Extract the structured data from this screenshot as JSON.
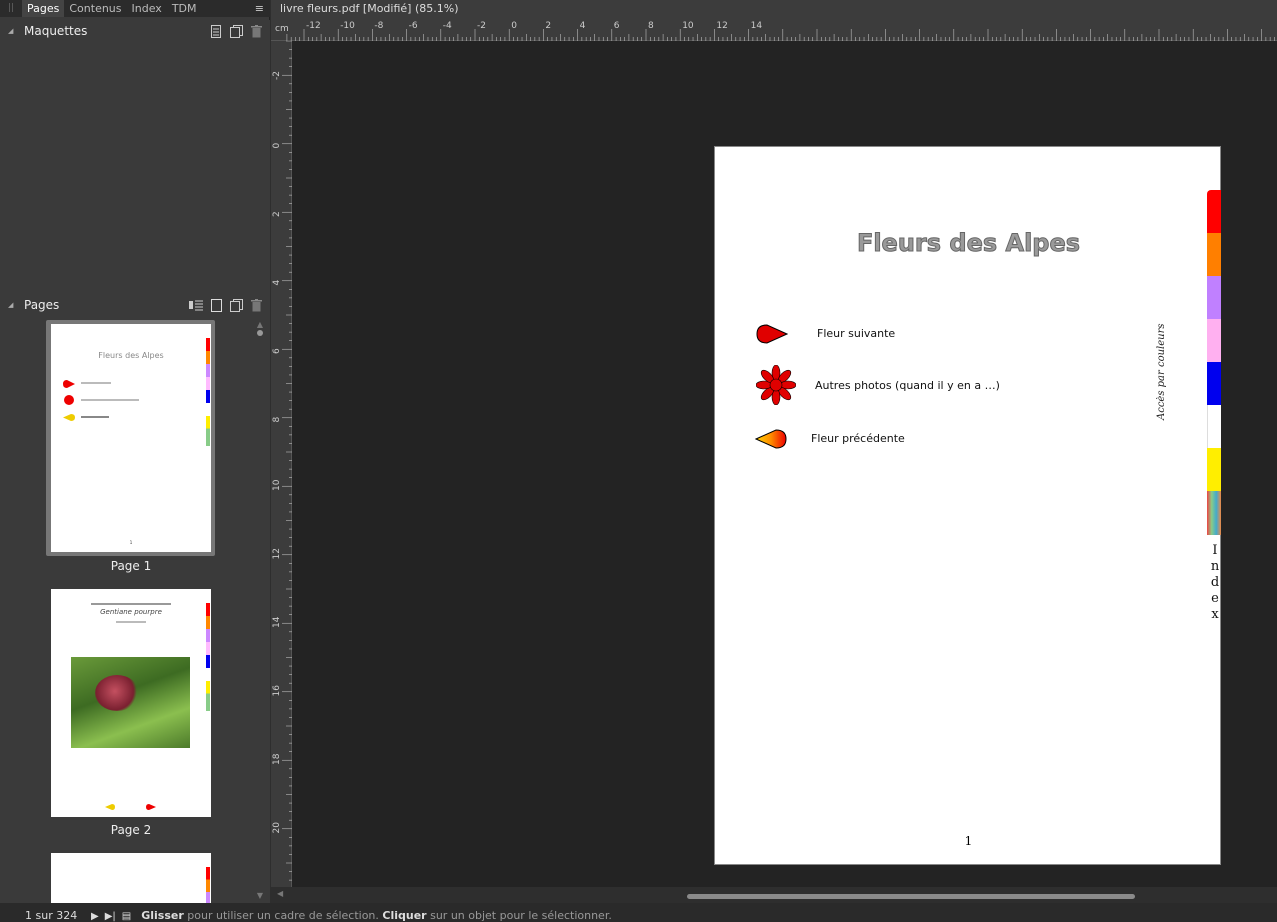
{
  "panel": {
    "tabs": [
      "Pages",
      "Contenus",
      "Index",
      "TDM"
    ],
    "active_tab": "Pages",
    "menu_glyph": "≡"
  },
  "maquettes": {
    "title": "Maquettes"
  },
  "pages": {
    "title": "Pages",
    "thumbnails": [
      {
        "label": "Page 1",
        "title": "Fleurs des Alpes"
      },
      {
        "label": "Page 2",
        "header": "Gentiane pourpre"
      },
      {
        "label": ""
      }
    ]
  },
  "document": {
    "tab_title": "livre fleurs.pdf [Modifié] (85.1%)",
    "ruler_unit": "cm",
    "h_ticks": [
      "-12",
      "-10",
      "-8",
      "-6",
      "-4",
      "-2",
      "0",
      "2",
      "4",
      "6",
      "8",
      "10",
      "12",
      "14"
    ],
    "v_ticks": [
      "-2",
      "0",
      "2",
      "4",
      "6",
      "8",
      "10",
      "12",
      "14",
      "16",
      "18",
      "20"
    ]
  },
  "page_content": {
    "title": "Fleurs des Alpes",
    "link_next": "Fleur suivante",
    "link_photos": "Autres photos (quand il y en a …)",
    "link_prev": "Fleur précédente",
    "side_label": "Accès par couleurs",
    "index_letters": [
      "I",
      "n",
      "d",
      "e",
      "x"
    ],
    "page_number": "1",
    "color_tabs": [
      "#ff0000",
      "#ff7f00",
      "#c080ff",
      "#ffb0f0",
      "#0000ee",
      "#ffffff",
      "#ffee00",
      "multicolor"
    ]
  },
  "status": {
    "page_indicator": "1 sur 324",
    "msg_bold1": "Glisser",
    "msg_text1": " pour utiliser un cadre de sélection. ",
    "msg_bold2": "Cliquer",
    "msg_text2": " sur un objet pour le sélectionner."
  }
}
